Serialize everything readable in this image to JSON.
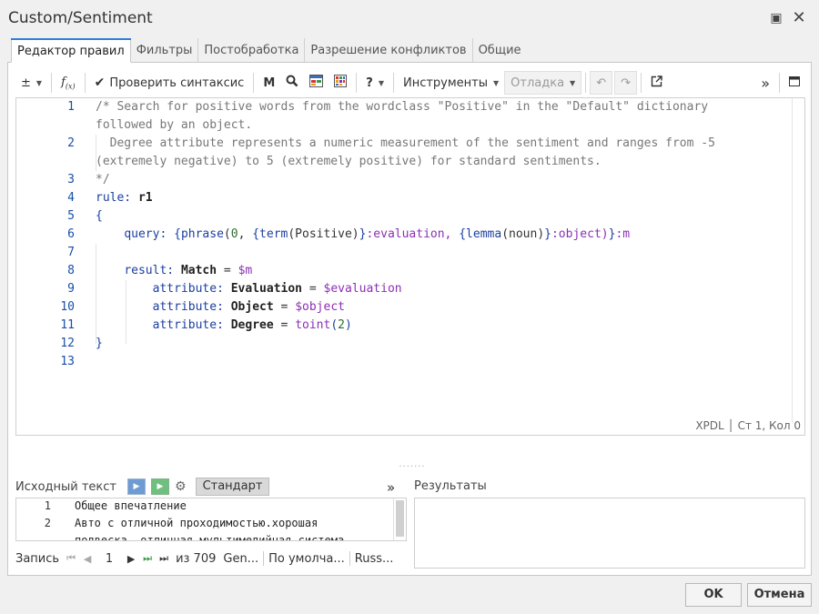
{
  "window": {
    "title": "Custom/Sentiment"
  },
  "tabs": [
    {
      "label": "Редактор правил",
      "active": true
    },
    {
      "label": "Фильтры"
    },
    {
      "label": "Постобработка"
    },
    {
      "label": "Разрешение конфликтов"
    },
    {
      "label": "Общие"
    }
  ],
  "toolbar": {
    "check_syntax": "Проверить синтаксис",
    "m_label": "M",
    "help_label": "?",
    "tools": "Инструменты",
    "debug": "Отладка"
  },
  "editor": {
    "line_numbers": [
      "1",
      "2",
      "3",
      "4",
      "5",
      "6",
      "7",
      "8",
      "9",
      "10",
      "11",
      "12",
      "13"
    ],
    "lines": {
      "l1a": "/* Search for positive words from the wordclass \"Positive\" in the \"Default\" dictionary",
      "l1b": "followed by an object.",
      "l2a": "  Degree attribute represents a numeric measurement of the sentiment and ranges from -5",
      "l2b": "(extremely negative) to 5 (extremely positive) for standard sentiments.",
      "l3": "*/",
      "l4_kw": "rule:",
      "l4_name": "r1",
      "l5": "{",
      "l6_kw": "query:",
      "l6_open": "{",
      "l6_fn": "phrase",
      "l6_args1": "(",
      "l6_zero": "0",
      "l6_args2": ", ",
      "l6_brace2": "{",
      "l6_term": "term",
      "l6_arg3": "(Positive)",
      "l6_brace3": "}",
      "l6_eval": ":evaluation, ",
      "l6_brace4": "{",
      "l6_lemma": "lemma",
      "l6_arg4": "(noun)",
      "l6_brace5": "}",
      "l6_obj": ":object)",
      "l6_brace6": "}",
      "l6_m": ":m",
      "l8_kw": "result:",
      "l8_match": "Match",
      "l8_eq": " = ",
      "l8_var": "$m",
      "l9_kw": "attribute:",
      "l9_name": "Evaluation",
      "l9_eq": " = ",
      "l9_var": "$evaluation",
      "l10_kw": "attribute:",
      "l10_name": "Object",
      "l10_eq": " = ",
      "l10_var": "$object",
      "l11_kw": "attribute:",
      "l11_name": "Degree",
      "l11_eq": " = ",
      "l11_fn": "toint",
      "l11_open": "(",
      "l11_num": "2",
      "l11_close": ")",
      "l12": "}"
    },
    "status": "XPDL │ Ст 1, Кол 0"
  },
  "source": {
    "label": "Исходный текст",
    "mode": "Стандарт",
    "rows": [
      {
        "num": "1",
        "text": "Общее впечатление"
      },
      {
        "num": "2",
        "text": "Авто с отличной проходимостью.хорошая"
      },
      {
        "num": "",
        "text": "подвеска, отличная мультимедийная система"
      }
    ]
  },
  "results": {
    "label": "Результаты"
  },
  "navigator": {
    "record_label": "Запись",
    "current": "1",
    "total": "из 709",
    "field1": "Gen...",
    "field2": "По умолча...",
    "field3": "Russ..."
  },
  "footer": {
    "ok": "OK",
    "cancel": "Отмена"
  },
  "colors": {
    "accent": "#2f7fd6",
    "keyword": "#1a3fa0",
    "variable": "#8b2fb5",
    "comment": "#777777"
  }
}
